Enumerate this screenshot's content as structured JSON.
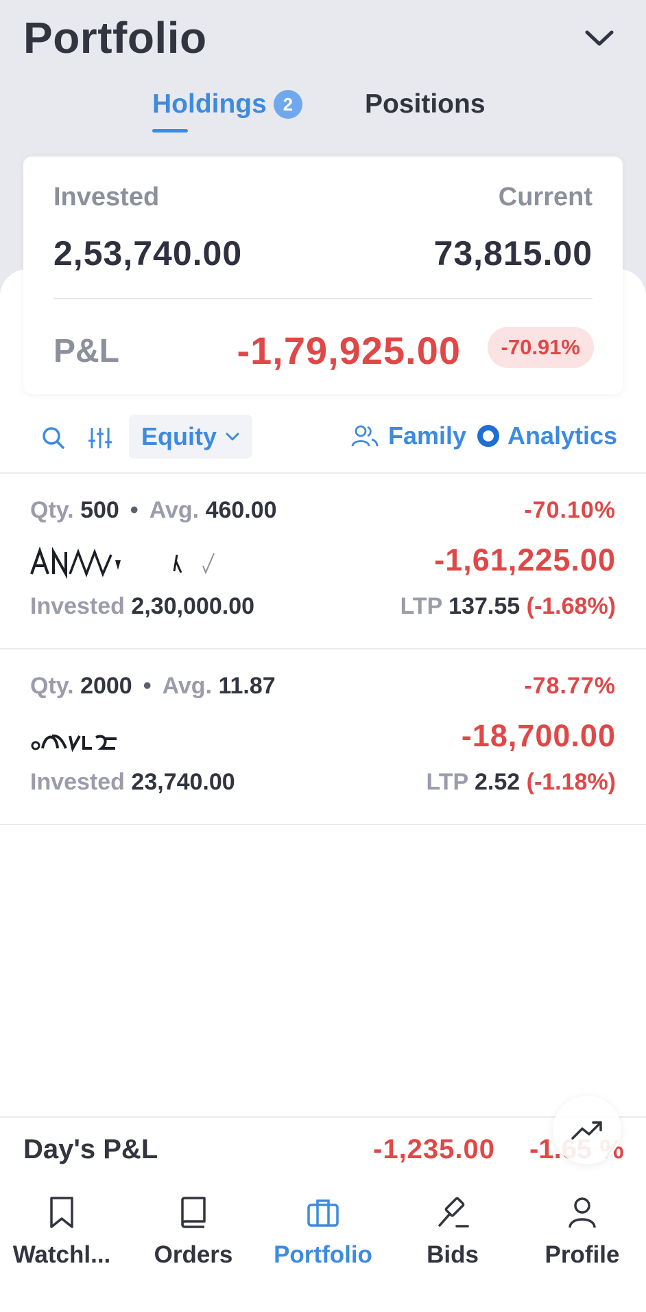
{
  "header": {
    "title": "Portfolio",
    "menu_icon": "chevron-down-icon"
  },
  "tabs": [
    {
      "label": "Holdings",
      "badge": "2",
      "active": true
    },
    {
      "label": "Positions",
      "active": false
    }
  ],
  "summary": {
    "invested_label": "Invested",
    "invested_value": "2,53,740.00",
    "current_label": "Current",
    "current_value": "73,815.00",
    "pnl_label": "P&L",
    "pnl_value": "-1,79,925.00",
    "pnl_percent": "-70.91%"
  },
  "filters": {
    "search_icon": "search-icon",
    "sort_icon": "sliders-icon",
    "segment": "Equity",
    "family_label": "Family",
    "analytics_label": "Analytics"
  },
  "holdings": [
    {
      "qty_label": "Qty.",
      "qty": "500",
      "avg_label": "Avg.",
      "avg": "460.00",
      "pnl_percent": "-70.10%",
      "pnl_value": "-1,61,225.00",
      "invested_label": "Invested",
      "invested": "2,30,000.00",
      "ltp_label": "LTP",
      "ltp": "137.55",
      "ltp_change": "(-1.68%)"
    },
    {
      "qty_label": "Qty.",
      "qty": "2000",
      "avg_label": "Avg.",
      "avg": "11.87",
      "pnl_percent": "-78.77%",
      "pnl_value": "-18,700.00",
      "invested_label": "Invested",
      "invested": "23,740.00",
      "ltp_label": "LTP",
      "ltp": "2.52",
      "ltp_change": "(-1.18%)"
    }
  ],
  "day_pnl": {
    "label": "Day's P&L",
    "value": "-1,235.00",
    "percent": "-1.65 %"
  },
  "nav": [
    {
      "label": "Watchl...",
      "icon": "bookmark-icon"
    },
    {
      "label": "Orders",
      "icon": "book-icon"
    },
    {
      "label": "Portfolio",
      "icon": "briefcase-icon",
      "active": true
    },
    {
      "label": "Bids",
      "icon": "gavel-icon"
    },
    {
      "label": "Profile",
      "icon": "user-icon"
    }
  ],
  "colors": {
    "accent": "#3d8be0",
    "loss": "#e04848",
    "loss_bg": "#fbe3e3",
    "header_bg": "#e8e9ee"
  }
}
